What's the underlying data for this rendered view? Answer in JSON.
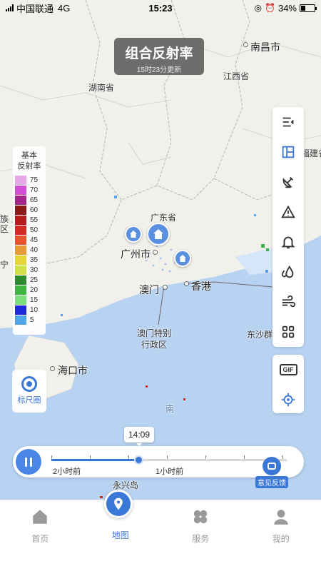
{
  "status_bar": {
    "carrier": "中国联通",
    "network": "4G",
    "time": "15:23",
    "battery": "34%",
    "battery_level": 0.34
  },
  "title_badge": {
    "title": "组合反射率",
    "subtitle": "15时23分更新"
  },
  "legend": {
    "title_line1": "基本",
    "title_line2": "反射率",
    "levels": [
      {
        "value": "75",
        "color": "#e6a8e8"
      },
      {
        "value": "70",
        "color": "#d24fd6"
      },
      {
        "value": "65",
        "color": "#a5238a"
      },
      {
        "value": "60",
        "color": "#8c1818"
      },
      {
        "value": "55",
        "color": "#b21c1c"
      },
      {
        "value": "50",
        "color": "#d12a22"
      },
      {
        "value": "45",
        "color": "#e5552c"
      },
      {
        "value": "40",
        "color": "#e89a38"
      },
      {
        "value": "35",
        "color": "#e6d43a"
      },
      {
        "value": "30",
        "color": "#cfe04a"
      },
      {
        "value": "25",
        "color": "#2e8a2e"
      },
      {
        "value": "20",
        "color": "#3eb53e"
      },
      {
        "value": "15",
        "color": "#7be07b"
      },
      {
        "value": "10",
        "color": "#1e2ad6"
      },
      {
        "value": "5",
        "color": "#4fa6e6"
      }
    ]
  },
  "map_labels": {
    "nanchang": "南昌市",
    "hunan": "湖南省",
    "jiangxi": "江西省",
    "fujian": "福建省",
    "guangdong": "广东省",
    "guangzhou": "广州市",
    "macau": "澳门",
    "hongkong": "香港",
    "macau_sar_line1": "澳门特别",
    "macau_sar_line2": "行政区",
    "dongsha": "东沙群",
    "haikou": "海口市",
    "nan": "南",
    "yongxing": "永兴岛",
    "left_zu": "族",
    "left_qu": "区",
    "left_ning": "宁"
  },
  "ruler": {
    "label": "标尺圈"
  },
  "toolbar": {
    "items": [
      "collapse-icon",
      "layers-icon",
      "radar-icon",
      "warning-icon",
      "bell-icon",
      "rain-icon",
      "wind-icon",
      "grid-icon"
    ],
    "gif_label": "GIF"
  },
  "timeline": {
    "current_time": "14:09",
    "label_left": "2小时前",
    "label_mid": "1小时前",
    "progress": 0.37
  },
  "feedback": {
    "label": "意见反馈"
  },
  "nav": {
    "items": [
      {
        "label": "首页",
        "icon": "home-icon"
      },
      {
        "label": "地图",
        "icon": "map-pin-icon"
      },
      {
        "label": "服务",
        "icon": "clover-icon"
      },
      {
        "label": "我的",
        "icon": "user-icon"
      }
    ],
    "active": "地图"
  },
  "colors": {
    "accent": "#3a78d8",
    "sea": "#b8d3f2",
    "land": "#f2f0eb"
  }
}
